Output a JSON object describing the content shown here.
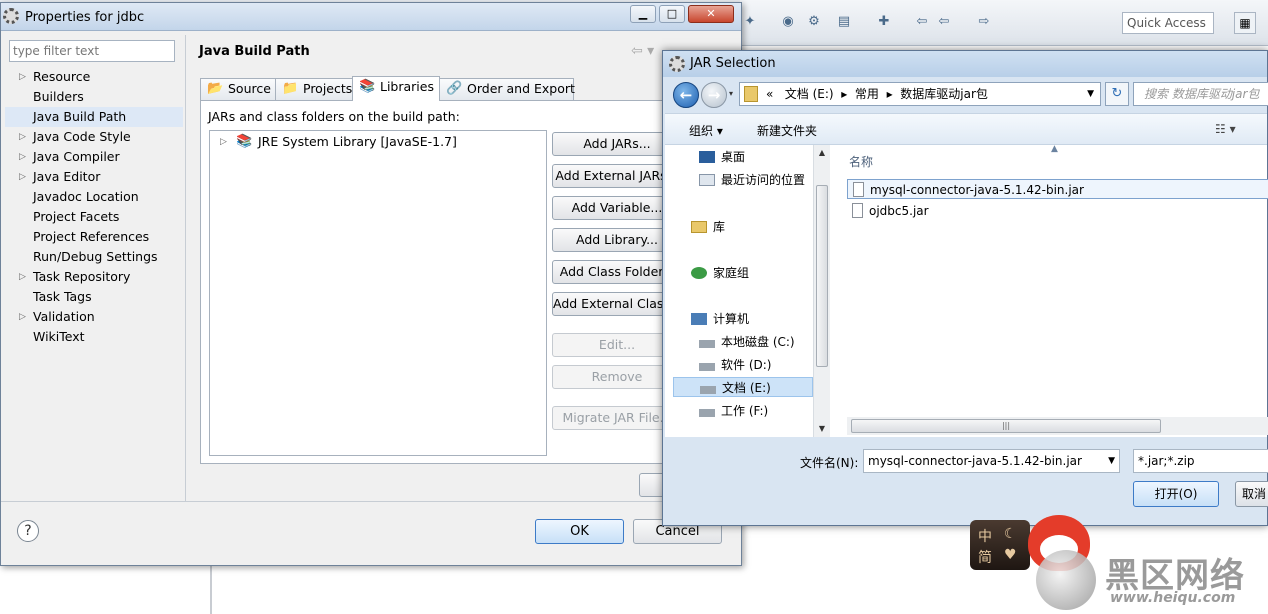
{
  "eclipse": {
    "quick_access": "Quick Access"
  },
  "props": {
    "title": "Properties for jdbc",
    "filter_placeholder": "type filter text",
    "page_title": "Java Build Path",
    "nav": [
      {
        "label": "Resource",
        "expandable": true
      },
      {
        "label": "Builders",
        "expandable": false
      },
      {
        "label": "Java Build Path",
        "expandable": false,
        "selected": true
      },
      {
        "label": "Java Code Style",
        "expandable": true
      },
      {
        "label": "Java Compiler",
        "expandable": true
      },
      {
        "label": "Java Editor",
        "expandable": true
      },
      {
        "label": "Javadoc Location",
        "expandable": false
      },
      {
        "label": "Project Facets",
        "expandable": false
      },
      {
        "label": "Project References",
        "expandable": false
      },
      {
        "label": "Run/Debug Settings",
        "expandable": false
      },
      {
        "label": "Task Repository",
        "expandable": true
      },
      {
        "label": "Task Tags",
        "expandable": false
      },
      {
        "label": "Validation",
        "expandable": true
      },
      {
        "label": "WikiText",
        "expandable": false
      }
    ],
    "tabs": [
      "Source",
      "Projects",
      "Libraries",
      "Order and Export"
    ],
    "jars_label": "JARs and class folders on the build path:",
    "library": "JRE System Library [JavaSE-1.7]",
    "buttons": [
      "Add JARs...",
      "Add External JARs...",
      "Add Variable...",
      "Add Library...",
      "Add Class Folder...",
      "Add External Class Folder..."
    ],
    "edit": "Edit...",
    "remove": "Remove",
    "migrate": "Migrate JAR File...",
    "ok": "OK",
    "cancel": "Cancel"
  },
  "jar": {
    "title": "JAR Selection",
    "path": [
      "«",
      "文档 (E:)",
      "▸",
      "常用",
      "▸",
      "数据库驱动jar包"
    ],
    "search_placeholder": "搜索 数据库驱动jar包",
    "organize": "组织 ▾",
    "new_folder": "新建文件夹",
    "nav": [
      "桌面",
      "最近访问的位置",
      "库",
      "家庭组",
      "计算机",
      "本地磁盘 (C:)",
      "软件 (D:)",
      "文档 (E:)",
      "工作 (F:)"
    ],
    "column_name": "名称",
    "files": [
      "mysql-connector-java-5.1.42-bin.jar",
      "ojdbc5.jar"
    ],
    "filename_label": "文件名(N):",
    "filename_value": "mysql-connector-java-5.1.42-bin.jar",
    "filter_value": "*.jar;*.zip",
    "open": "打开(O)",
    "cancel": "取消"
  },
  "ime": {
    "c1": "中",
    "c2": "简"
  },
  "watermark": {
    "main": "黑区网络",
    "url": "www.heiqu.com"
  },
  "colors": {
    "accent": "#3d7bc7",
    "title_bar": "#c3d5ea",
    "selection": "#dde8f6"
  }
}
